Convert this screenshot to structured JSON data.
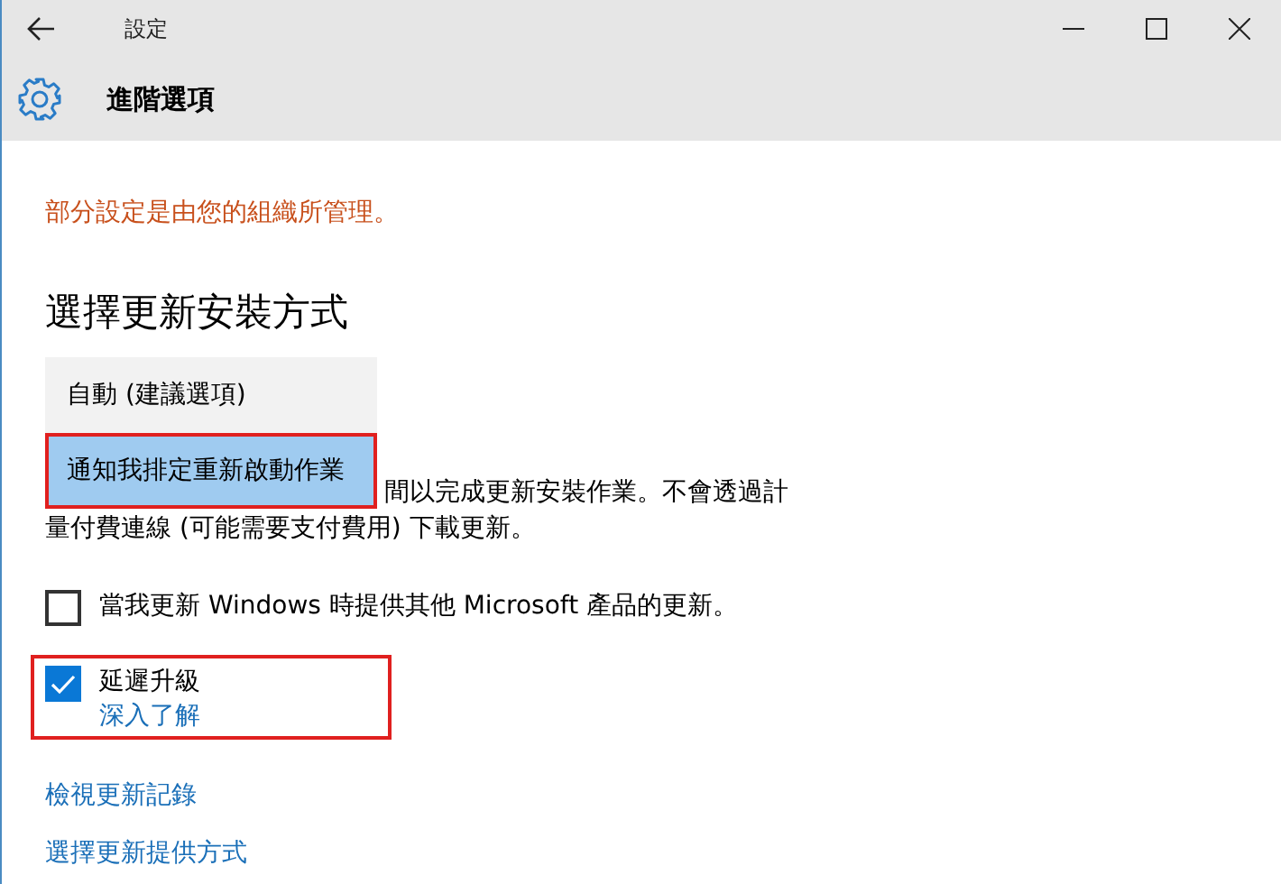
{
  "window": {
    "title": "設定"
  },
  "header": {
    "title": "進階選項"
  },
  "notice": "部分設定是由您的組織所管理。",
  "section_title": "選擇更新安裝方式",
  "install_dropdown": {
    "options": [
      {
        "label": "自動 (建議選項)",
        "selected": false,
        "highlighted": false
      },
      {
        "label": "通知我排定重新啟動作業",
        "selected": true,
        "highlighted": true
      }
    ]
  },
  "description": [
    "間以完成更新安裝作業。不會透過計",
    "量付費連線 (可能需要支付費用) 下載更新。"
  ],
  "options": [
    {
      "label": "當我更新 Windows 時提供其他 Microsoft 產品的更新。",
      "checked": false,
      "highlighted": false
    },
    {
      "label": "延遲升級",
      "checked": true,
      "highlighted": true,
      "link": "深入了解"
    }
  ],
  "links": [
    "檢視更新記錄",
    "選擇更新提供方式"
  ]
}
